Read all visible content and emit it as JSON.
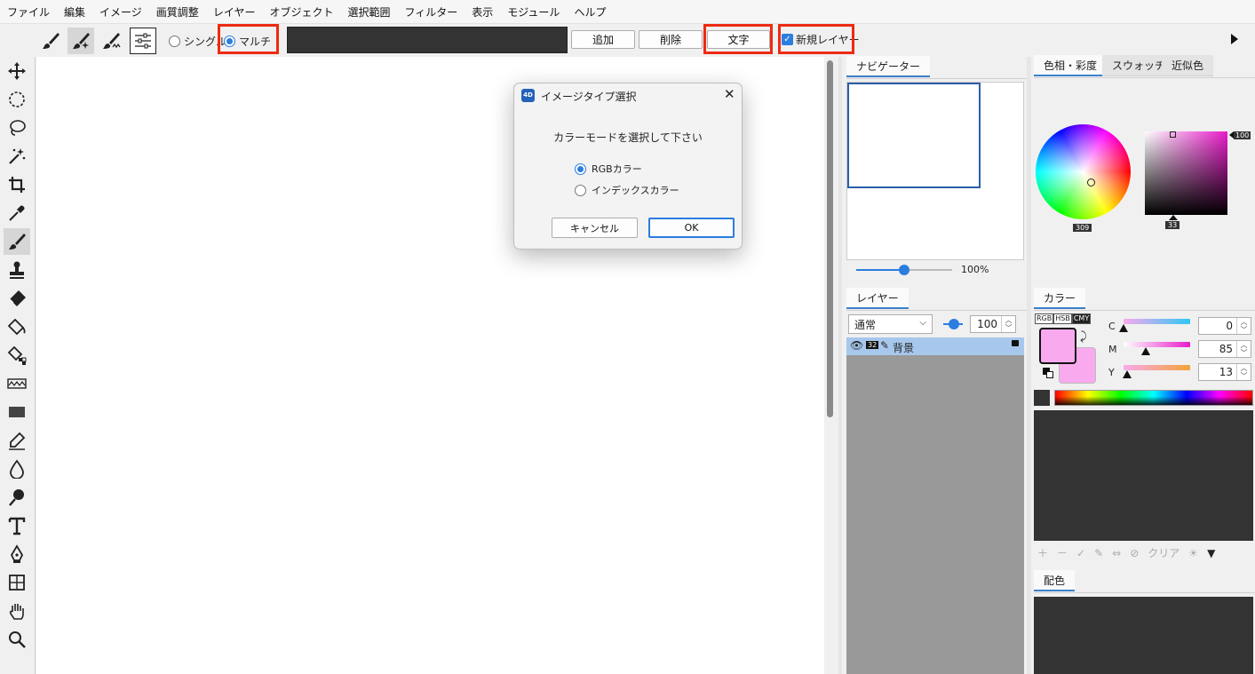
{
  "menu": [
    "ファイル",
    "編集",
    "イメージ",
    "画質調整",
    "レイヤー",
    "オブジェクト",
    "選択範囲",
    "フィルター",
    "表示",
    "モジュール",
    "ヘルプ"
  ],
  "toolbar": {
    "single_label": "シングル",
    "multi_label": "マルチ",
    "add_label": "追加",
    "delete_label": "削除",
    "text_label": "文字",
    "new_layer_label": "新規レイヤー",
    "new_layer_checked": true
  },
  "dialog": {
    "title": "イメージタイプ選択",
    "message": "カラーモードを選択して下さい",
    "options": [
      "RGBカラー",
      "インデックスカラー"
    ],
    "selected_option": "RGBカラー",
    "cancel_label": "キャンセル",
    "ok_label": "OK"
  },
  "navigator": {
    "tab_label": "ナビゲーター",
    "zoom": "100%",
    "zoom_fraction": 0.5
  },
  "layers": {
    "tab_label": "レイヤー",
    "blend_mode": "通常",
    "opacity": "100",
    "layer_bits": "32",
    "layer_name": "背景"
  },
  "color_tabs": [
    "色相・彩度",
    "スウォッチ",
    "近似色"
  ],
  "color_picker": {
    "hue_value": "309",
    "sat_value": "33",
    "bright_value": "100"
  },
  "color_panel": {
    "tab_label": "カラー",
    "modes": [
      "RGB",
      "HSB",
      "CMY"
    ],
    "active_mode": "CMY",
    "channels": [
      {
        "label": "C",
        "value": "0"
      },
      {
        "label": "M",
        "value": "85"
      },
      {
        "label": "Y",
        "value": "13"
      }
    ],
    "swatch_color": "#f9aaee",
    "clear_label": "クリア"
  },
  "scheme": {
    "tab_label": "配色"
  },
  "colors": {
    "highlight": "#ee2a12",
    "accent": "#2b7de0"
  }
}
